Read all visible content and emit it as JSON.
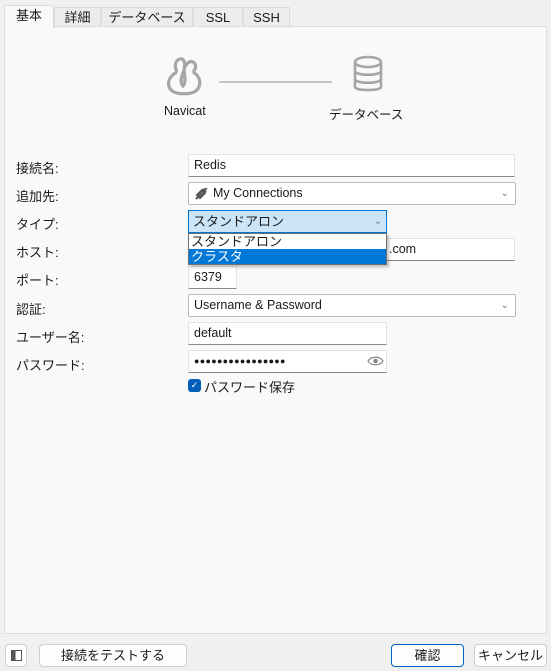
{
  "tabs": [
    {
      "label": "基本",
      "active": true
    },
    {
      "label": "詳細",
      "active": false
    },
    {
      "label": "データベース",
      "active": false
    },
    {
      "label": "SSL",
      "active": false
    },
    {
      "label": "SSH",
      "active": false
    }
  ],
  "flow": {
    "source_label": "Navicat",
    "source_icon": "navicat-logo-icon",
    "target_label": "データベース",
    "target_icon": "database-icon"
  },
  "form": {
    "connection_name": {
      "label": "接続名:",
      "value": "Redis"
    },
    "add_to": {
      "label": "追加先:",
      "value": "My Connections",
      "icon": "connection-plug-icon"
    },
    "type": {
      "label": "タイプ:",
      "value": "スタンドアロン",
      "options": [
        "スタンドアロン",
        "クラスタ"
      ],
      "highlighted": "クラスタ"
    },
    "host": {
      "label": "ホスト:",
      "visible_value": ".com"
    },
    "port": {
      "label": "ポート:",
      "value": "6379"
    },
    "auth": {
      "label": "認証:",
      "value": "Username & Password"
    },
    "username": {
      "label": "ユーザー名:",
      "value": "default"
    },
    "password": {
      "label": "パスワード:",
      "value": "●●●●●●●●●●●●●●●●"
    },
    "save_password": {
      "label": "パスワード保存",
      "checked": true
    }
  },
  "footer": {
    "test_button": "接続をテストする",
    "ok_button": "確認",
    "cancel_button": "キャンセル"
  },
  "colors": {
    "accent": "#0078d7",
    "selection_bg": "#cce4f7",
    "checkbox": "#005fb8"
  }
}
